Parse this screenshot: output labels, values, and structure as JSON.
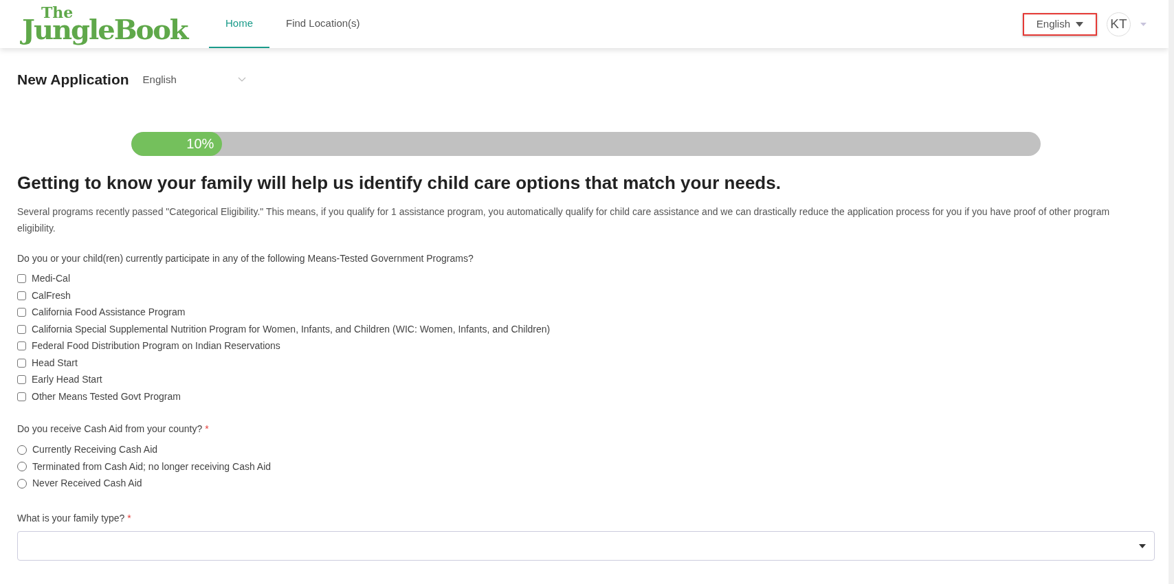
{
  "logo": {
    "top": "The",
    "bottom": "JungleBook"
  },
  "nav": [
    {
      "label": "Home",
      "selected": true
    },
    {
      "label": "Find Location(s)",
      "selected": false
    }
  ],
  "language_menu": {
    "label": "English",
    "highlighted": true
  },
  "user": {
    "initials": "KT"
  },
  "page": {
    "title": "New Application",
    "language": "English"
  },
  "progress": {
    "level": 0.1,
    "reading": "10%"
  },
  "heading": "Getting to know your family will help us identify child care options that match your needs.",
  "intro": "Several programs recently passed \"Categorical Eligibility.\" This means, if you qualify for 1 assistance program, you automatically qualify for child care assistance and we can drastically reduce the application process for you if you have proof of other program eligibility.",
  "programs": {
    "question": "Do you or your child(ren) currently participate in any of the following Means-Tested Government Programs?",
    "options": [
      {
        "label": "Medi-Cal",
        "checked": false
      },
      {
        "label": "CalFresh",
        "checked": false
      },
      {
        "label": "California Food Assistance Program",
        "checked": false
      },
      {
        "label": "California Special Supplemental Nutrition Program for Women, Infants, and Children (WIC: Women, Infants, and Children)",
        "checked": false
      },
      {
        "label": "Federal Food Distribution Program on Indian Reservations",
        "checked": false
      },
      {
        "label": "Head Start",
        "checked": false
      },
      {
        "label": "Early Head Start",
        "checked": false
      },
      {
        "label": "Other Means Tested Govt Program",
        "checked": false
      }
    ]
  },
  "cash_aid": {
    "question": "Do you receive Cash Aid from your county?",
    "required_mark": "*",
    "options": [
      {
        "label": "Currently Receiving Cash Aid",
        "selected": false
      },
      {
        "label": "Terminated from Cash Aid; no longer receiving Cash Aid",
        "selected": false
      },
      {
        "label": "Never Received Cash Aid",
        "selected": false
      }
    ]
  },
  "family_type": {
    "question": "What is your family type?",
    "required_mark": "*"
  }
}
